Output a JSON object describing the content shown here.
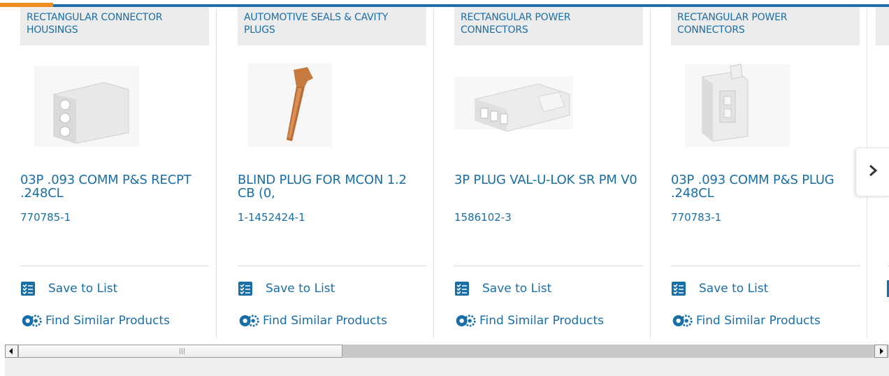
{
  "colors": {
    "accent": "#1a6ea6",
    "topbar_blue": "#1f6fa8",
    "topbar_orange": "#f28c1f"
  },
  "cards": [
    {
      "category": "RECTANGULAR CONNECTOR HOUSINGS",
      "title": "03P .093 COMM P&S RECPT .248CL",
      "part_number": "770785-1",
      "image_icon": "white-3-pin-connector-housing",
      "save_label": "Save to List",
      "find_label": "Find Similar Products"
    },
    {
      "category": "AUTOMOTIVE SEALS & CAVITY PLUGS",
      "title": "BLIND PLUG FOR MCON 1.2 CB (0,",
      "part_number": "1-1452424-1",
      "image_icon": "brown-blind-plug",
      "save_label": "Save to List",
      "find_label": "Find Similar Products"
    },
    {
      "category": "RECTANGULAR POWER CONNECTORS",
      "title": "3P PLUG VAL-U-LOK SR PM V0",
      "part_number": "1586102-3",
      "image_icon": "white-3-pin-plug",
      "save_label": "Save to List",
      "find_label": "Find Similar Products"
    },
    {
      "category": "RECTANGULAR POWER CONNECTORS",
      "title": "03P .093 COMM P&S PLUG .248CL",
      "part_number": "770783-1",
      "image_icon": "white-plug-housing",
      "save_label": "Save to List",
      "find_label": "Find Similar Products"
    }
  ],
  "nav": {
    "next_icon": "chevron-right-icon"
  }
}
